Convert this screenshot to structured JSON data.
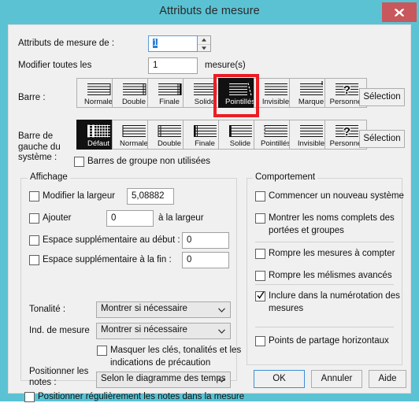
{
  "window": {
    "title": "Attributs de mesure",
    "close_label": "x",
    "accent_color": "#5bc2d4",
    "close_color": "#c8585b",
    "highlight_color": "#ec1c24"
  },
  "top": {
    "measure_from_label": "Attributs de mesure de :",
    "measure_from_value": "1",
    "change_all_label": "Modifier toutes les",
    "change_all_value": "1",
    "measures_suffix": "mesure(s)"
  },
  "barre": {
    "label": "Barre :",
    "select_label": "Sélection",
    "selected_index": 4,
    "options": [
      {
        "label": "Normale",
        "icon": "barline-normal-icon"
      },
      {
        "label": "Double",
        "icon": "barline-double-icon"
      },
      {
        "label": "Finale",
        "icon": "barline-final-icon"
      },
      {
        "label": "Solide",
        "icon": "barline-heavy-icon"
      },
      {
        "label": "Pointillés",
        "icon": "barline-dashed-icon"
      },
      {
        "label": "Invisible",
        "icon": "barline-invisible-icon"
      },
      {
        "label": "Marque",
        "icon": "barline-tick-icon"
      },
      {
        "label": "Personnel",
        "icon": "barline-custom-icon"
      }
    ]
  },
  "barre_gauche": {
    "label": "Barre de\ngauche du\nsystème :",
    "label_line1": "Barre de",
    "label_line2": "gauche du",
    "label_line3": "système :",
    "select_label": "Sélection",
    "selected_index": 0,
    "options": [
      {
        "label": "Défaut",
        "icon": "leftbar-default-icon"
      },
      {
        "label": "Normale",
        "icon": "leftbar-normal-icon"
      },
      {
        "label": "Double",
        "icon": "leftbar-double-icon"
      },
      {
        "label": "Finale",
        "icon": "leftbar-final-icon"
      },
      {
        "label": "Solide",
        "icon": "leftbar-heavy-icon"
      },
      {
        "label": "Pointillés",
        "icon": "leftbar-dashed-icon"
      },
      {
        "label": "Invisible",
        "icon": "leftbar-invisible-icon"
      },
      {
        "label": "Personnel",
        "icon": "leftbar-custom-icon"
      }
    ]
  },
  "unused_group_bars": {
    "label": "Barres de groupe non utilisées",
    "checked": false
  },
  "affichage": {
    "title": "Affichage",
    "modify_width": {
      "label": "Modifier la largeur",
      "checked": false,
      "value": "5,08882"
    },
    "add": {
      "label": "Ajouter",
      "checked": false,
      "value": "0",
      "suffix": "à la largeur"
    },
    "extra_space_start": {
      "label": "Espace supplémentaire au début :",
      "checked": false,
      "value": "0"
    },
    "extra_space_end": {
      "label": "Espace supplémentaire à la fin :",
      "checked": false,
      "value": "0"
    },
    "tonalite": {
      "label": "Tonalité :",
      "value": "Montrer si nécessaire"
    },
    "ind_mesure": {
      "label": "Ind. de mesure",
      "value": "Montrer si nécessaire"
    },
    "hide_keys": {
      "label": "Masquer les clés, tonalités et les indications de précaution",
      "checked": false
    },
    "positionner_notes": {
      "label_line1": "Positionner les",
      "label_line2": "notes :",
      "value": "Selon le diagramme des temps"
    },
    "position_regularly": {
      "label": "Positionner régulièrement les notes dans la mesure",
      "checked": false
    }
  },
  "comportement": {
    "title": "Comportement",
    "items": [
      {
        "label": "Commencer un nouveau système",
        "checked": false,
        "wrap": false
      },
      {
        "label": "Montrer les noms complets des portées et groupes",
        "checked": false,
        "wrap": true
      },
      {
        "label": "Rompre les mesures à compter",
        "checked": false,
        "wrap": false
      },
      {
        "label": "Rompre les mélismes avancés",
        "checked": false,
        "wrap": false
      },
      {
        "label": "Inclure dans la numérotation des mesures",
        "checked": true,
        "wrap": true
      },
      {
        "label": "Points de partage horizontaux",
        "checked": false,
        "wrap": false
      }
    ]
  },
  "footer": {
    "ok": "OK",
    "cancel": "Annuler",
    "help": "Aide"
  }
}
